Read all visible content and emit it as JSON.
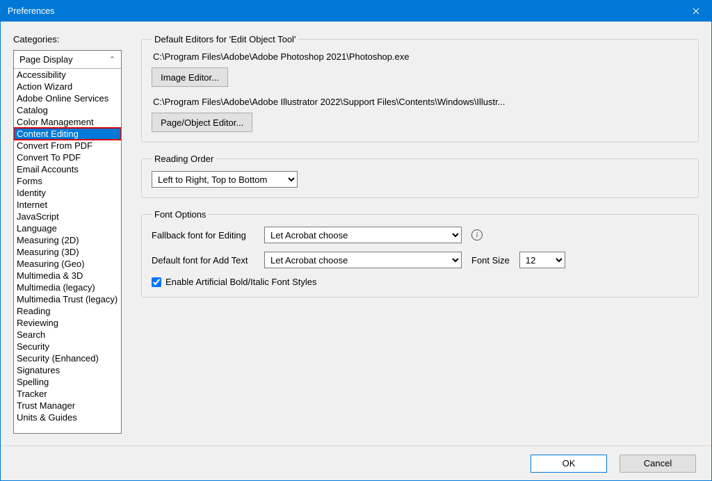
{
  "window": {
    "title": "Preferences"
  },
  "categories": {
    "label": "Categories:",
    "header": "Page Display",
    "items": [
      "Accessibility",
      "Action Wizard",
      "Adobe Online Services",
      "Catalog",
      "Color Management",
      "Content Editing",
      "Convert From PDF",
      "Convert To PDF",
      "Email Accounts",
      "Forms",
      "Identity",
      "Internet",
      "JavaScript",
      "Language",
      "Measuring (2D)",
      "Measuring (3D)",
      "Measuring (Geo)",
      "Multimedia & 3D",
      "Multimedia (legacy)",
      "Multimedia Trust (legacy)",
      "Reading",
      "Reviewing",
      "Search",
      "Security",
      "Security (Enhanced)",
      "Signatures",
      "Spelling",
      "Tracker",
      "Trust Manager",
      "Units & Guides"
    ],
    "selectedIndex": 5
  },
  "sections": {
    "defaultEditors": {
      "legend": "Default Editors for 'Edit Object Tool'",
      "imagePath": "C:\\Program Files\\Adobe\\Adobe Photoshop 2021\\Photoshop.exe",
      "imageBtn": "Image Editor...",
      "pagePath": "C:\\Program Files\\Adobe\\Adobe Illustrator 2022\\Support Files\\Contents\\Windows\\Illustr...",
      "pageBtn": "Page/Object Editor..."
    },
    "readingOrder": {
      "legend": "Reading Order",
      "value": "Left to Right, Top to Bottom"
    },
    "fontOptions": {
      "legend": "Font Options",
      "fallbackLabel": "Fallback font for Editing",
      "fallbackValue": "Let Acrobat choose",
      "defaultLabel": "Default font for Add Text",
      "defaultValue": "Let Acrobat choose",
      "fontSizeLabel": "Font Size",
      "fontSizeValue": "12",
      "checkboxLabel": "Enable Artificial Bold/Italic Font Styles",
      "checkboxChecked": true
    }
  },
  "footer": {
    "ok": "OK",
    "cancel": "Cancel"
  }
}
